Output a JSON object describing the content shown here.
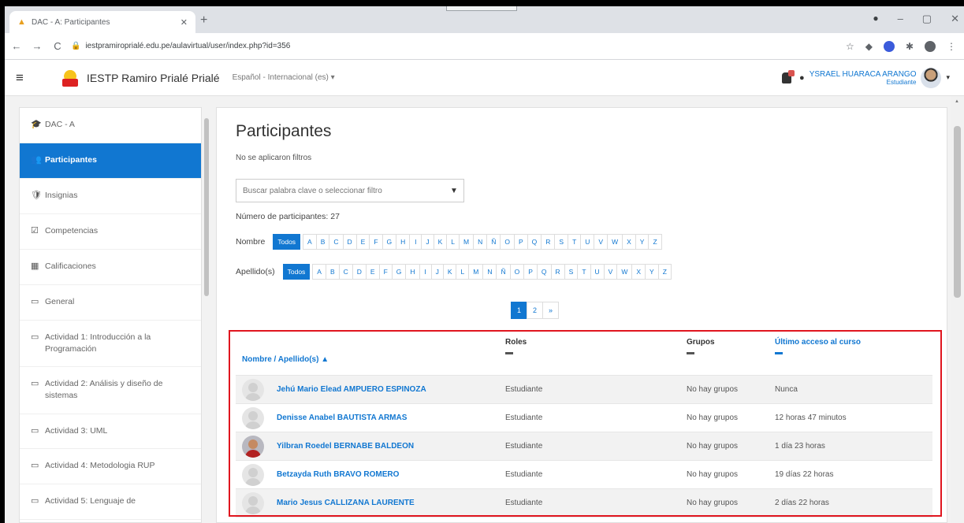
{
  "browser": {
    "tab_title": "DAC - A: Participantes",
    "tab_close": "✕",
    "new_tab": "+",
    "url": "iestpramiroprialé.edu.pe/aulavirtual/user/index.php?id=356",
    "nav": {
      "back": "←",
      "forward": "→",
      "reload": "C"
    },
    "window_controls": {
      "minimize": "–",
      "maximize": "▢",
      "close": "✕",
      "extra": "●"
    }
  },
  "header": {
    "menu_icon": "≡",
    "site_name": "IESTP Ramiro Prialé Prialé",
    "language": "Español - Internacional (es) ▾",
    "user_name": "YSRAEL HUARACA ARANGO",
    "user_role": "Estudiante",
    "user_caret": "▾"
  },
  "sidebar": {
    "items": [
      {
        "icon": "🎓",
        "label": "DAC - A",
        "active": false
      },
      {
        "icon": "👥",
        "label": "Participantes",
        "active": true
      },
      {
        "icon": "🛡",
        "label": "Insignias",
        "active": false
      },
      {
        "icon": "☑",
        "label": "Competencias",
        "active": false
      },
      {
        "icon": "▦",
        "label": "Calificaciones",
        "active": false
      },
      {
        "icon": "▭",
        "label": "General",
        "active": false
      },
      {
        "icon": "▭",
        "label": "Actividad 1: Introducción a la Programación",
        "active": false
      },
      {
        "icon": "▭",
        "label": "Actividad 2: Análisis y diseño de sistemas",
        "active": false
      },
      {
        "icon": "▭",
        "label": "Actividad 3: UML",
        "active": false
      },
      {
        "icon": "▭",
        "label": "Actividad 4: Metodologia RUP",
        "active": false
      },
      {
        "icon": "▭",
        "label": "Actividad 5: Lenguaje de",
        "active": false
      }
    ]
  },
  "main": {
    "title": "Participantes",
    "no_filters": "No se aplicaron filtros",
    "filter_placeholder": "Buscar palabra clave o seleccionar filtro",
    "filter_dropdown": "▼",
    "participant_count": "Número de participantes: 27",
    "first_name_label": "Nombre",
    "last_name_label": "Apellido(s)",
    "all_label": "Todos",
    "letters": [
      "A",
      "B",
      "C",
      "D",
      "E",
      "F",
      "G",
      "H",
      "I",
      "J",
      "K",
      "L",
      "M",
      "N",
      "Ñ",
      "O",
      "P",
      "Q",
      "R",
      "S",
      "T",
      "U",
      "V",
      "W",
      "X",
      "Y",
      "Z"
    ],
    "pager": [
      "1",
      "2",
      "»"
    ]
  },
  "table": {
    "headers": {
      "name": "Nombre / Apellido(s) ▲",
      "roles": "Roles",
      "groups": "Grupos",
      "last_access": "Último acceso al curso"
    },
    "rows": [
      {
        "name": "Jehú Mario Elead AMPUERO ESPINOZA",
        "role": "Estudiante",
        "groups": "No hay grupos",
        "last_access": "Nunca",
        "photo": false
      },
      {
        "name": "Denisse Anabel BAUTISTA ARMAS",
        "role": "Estudiante",
        "groups": "No hay grupos",
        "last_access": "12 horas 47 minutos",
        "photo": false
      },
      {
        "name": "Yilbran Roedel BERNABE BALDEON",
        "role": "Estudiante",
        "groups": "No hay grupos",
        "last_access": "1 día 23 horas",
        "photo": true
      },
      {
        "name": "Betzayda Ruth BRAVO ROMERO",
        "role": "Estudiante",
        "groups": "No hay grupos",
        "last_access": "19 días 22 horas",
        "photo": false
      },
      {
        "name": "Mario Jesus CALLIZANA LAURENTE",
        "role": "Estudiante",
        "groups": "No hay grupos",
        "last_access": "2 días 22 horas",
        "photo": false
      }
    ]
  },
  "colors": {
    "accent": "#1177d1",
    "highlight_border": "#e0161f",
    "page_bg": "#f2f2f2"
  }
}
